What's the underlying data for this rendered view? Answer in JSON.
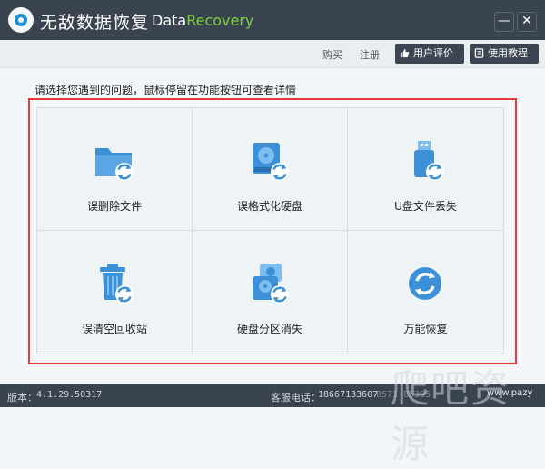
{
  "app": {
    "title_cn": "无敌数据恢复",
    "title_en_1": "Data",
    "title_en_2": "Recovery",
    "min_glyph": "—",
    "close_glyph": "✕"
  },
  "toolbar": {
    "buy_label": "购买",
    "register_label": "注册",
    "review_label": "用户评价",
    "tutorial_label": "使用教程"
  },
  "main": {
    "prompt": "请选择您遇到的问题，鼠标停留在功能按钮可查看详情",
    "options": [
      {
        "label": "误删除文件",
        "icon": "folder-recover-icon"
      },
      {
        "label": "误格式化硬盘",
        "icon": "disk-format-recover-icon"
      },
      {
        "label": "U盘文件丢失",
        "icon": "usb-recover-icon"
      },
      {
        "label": "误清空回收站",
        "icon": "recycle-bin-recover-icon"
      },
      {
        "label": "硬盘分区消失",
        "icon": "partition-recover-icon"
      },
      {
        "label": "万能恢复",
        "icon": "universal-recover-icon"
      }
    ]
  },
  "status": {
    "version_label": "版本：",
    "version_value": "4.1.29.50317",
    "service_label": "客服电话：",
    "service_value": "18667133607",
    "service_extra": "0571-85395"
  },
  "watermark": {
    "text": "爬吧资源",
    "sub": "www.pazy"
  },
  "colors": {
    "titlebar": "#3a4350",
    "accent_green": "#7fd13b",
    "icon_blue": "#3d8fd6",
    "highlight_red": "#e33b3b"
  }
}
